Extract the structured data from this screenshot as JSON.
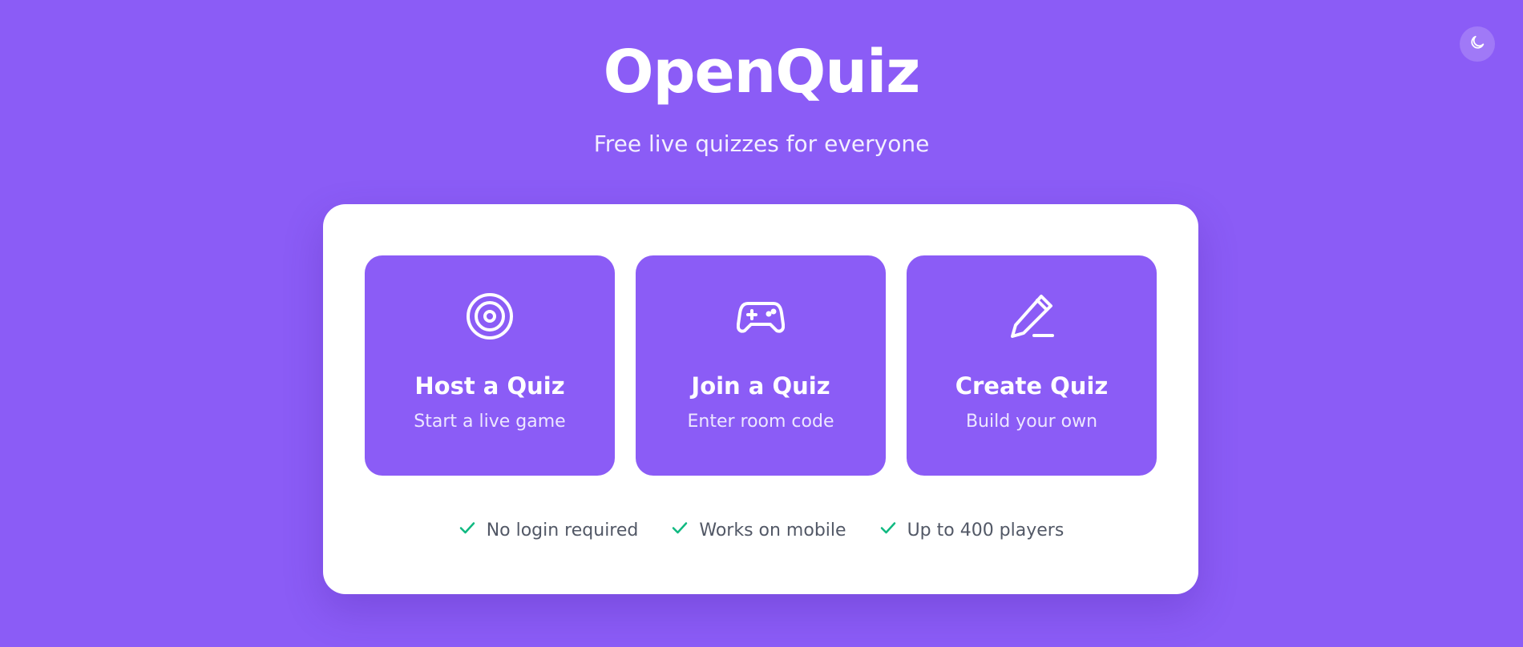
{
  "header": {
    "title": "OpenQuiz",
    "subtitle": "Free live quizzes for everyone",
    "theme_toggle_icon": "moon-icon"
  },
  "options": [
    {
      "icon": "target-icon",
      "title": "Host a Quiz",
      "subtitle": "Start a live game"
    },
    {
      "icon": "gamepad-icon",
      "title": "Join a Quiz",
      "subtitle": "Enter room code"
    },
    {
      "icon": "pencil-icon",
      "title": "Create Quiz",
      "subtitle": "Build your own"
    }
  ],
  "features": [
    "No login required",
    "Works on mobile",
    "Up to 400 players"
  ],
  "colors": {
    "background": "#8b5cf6",
    "card": "#ffffff",
    "check": "#10b981",
    "feature_text": "#525866"
  }
}
